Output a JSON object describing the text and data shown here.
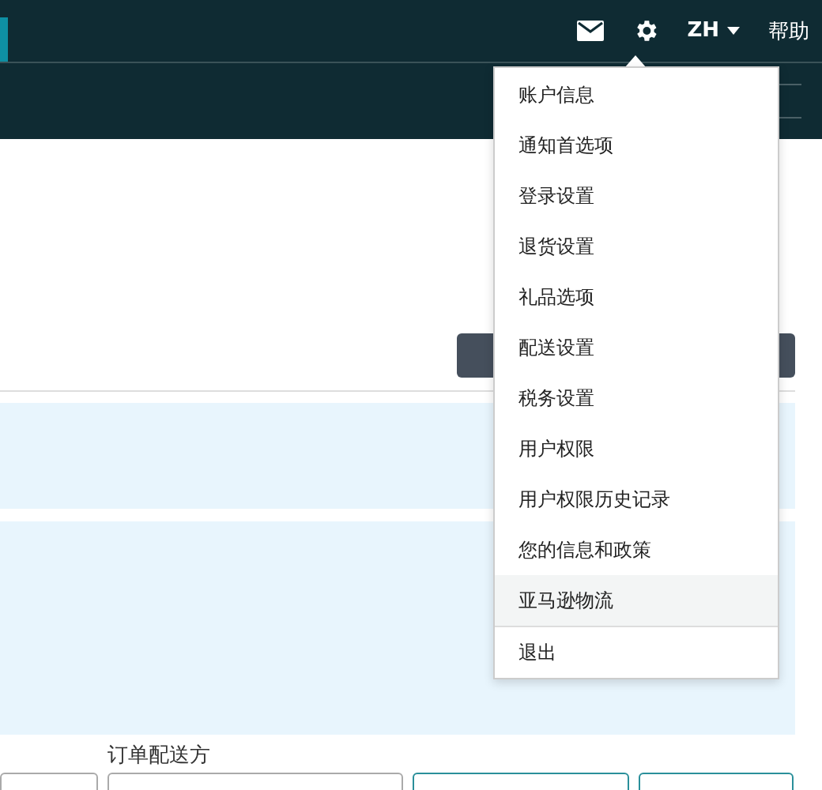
{
  "header": {
    "language": "ZH",
    "help": "帮助"
  },
  "menu": {
    "groups": [
      [
        {
          "label": "账户信息",
          "selected": false
        },
        {
          "label": "通知首选项",
          "selected": false
        },
        {
          "label": "登录设置",
          "selected": false
        },
        {
          "label": "退货设置",
          "selected": false
        },
        {
          "label": "礼品选项",
          "selected": false
        },
        {
          "label": "配送设置",
          "selected": false
        },
        {
          "label": "税务设置",
          "selected": false
        },
        {
          "label": "用户权限",
          "selected": false
        },
        {
          "label": "用户权限历史记录",
          "selected": false
        },
        {
          "label": "您的信息和政策",
          "selected": false
        },
        {
          "label": "亚马逊物流",
          "selected": true
        }
      ],
      [
        {
          "label": "退出",
          "selected": false
        }
      ]
    ]
  },
  "form": {
    "label": "订单配送方"
  }
}
